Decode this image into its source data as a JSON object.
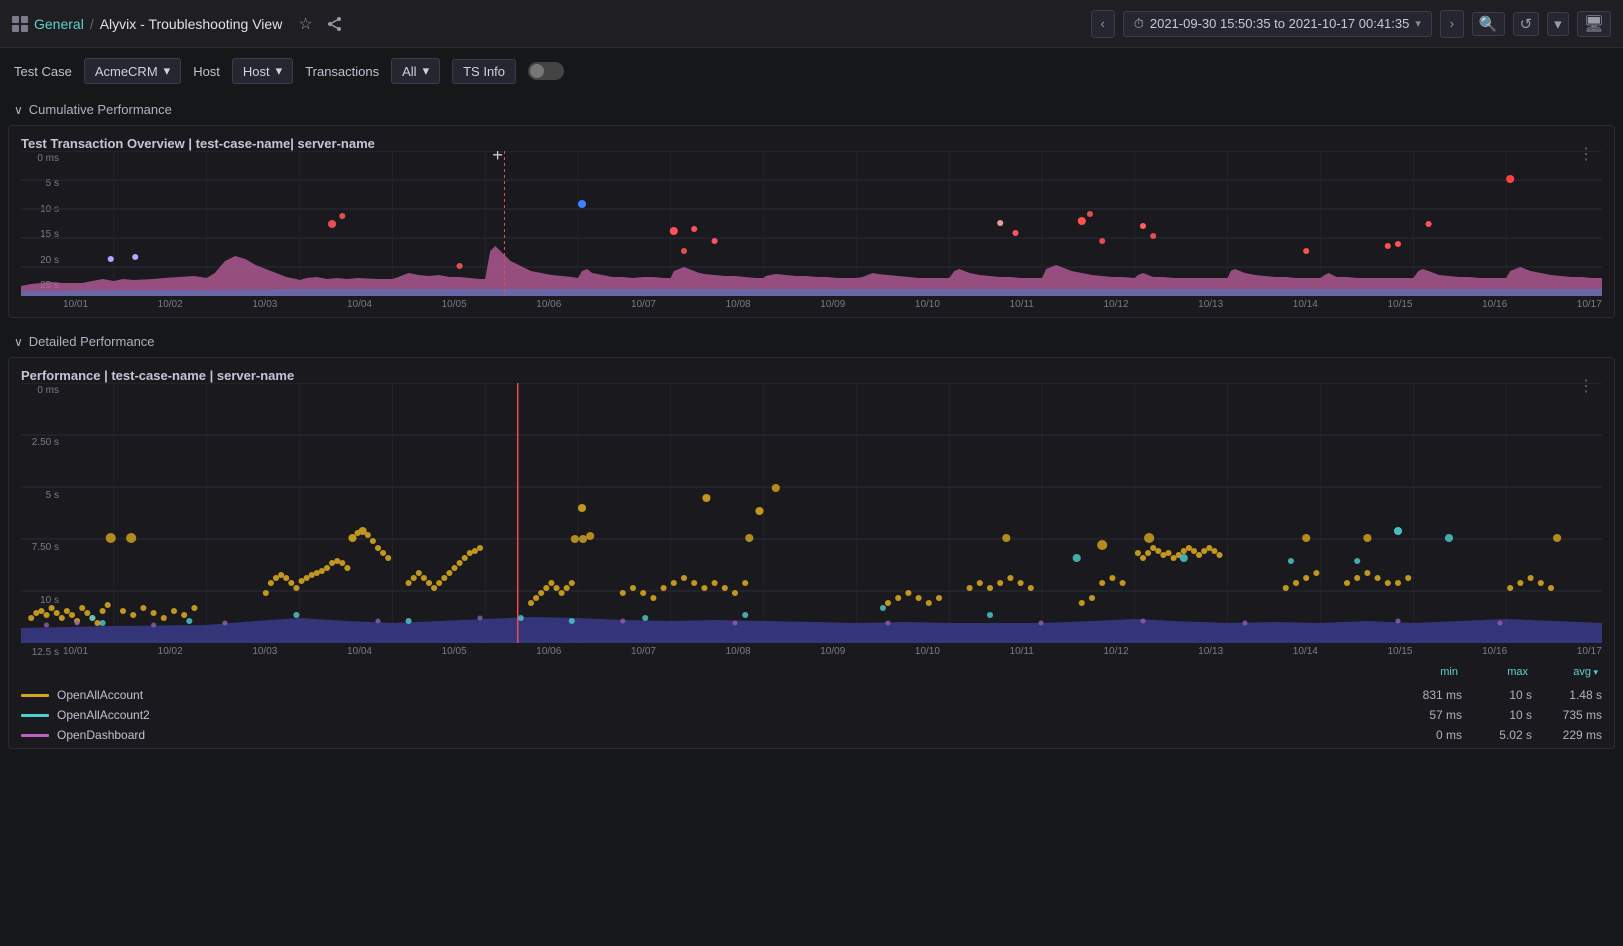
{
  "topbar": {
    "app_icon": "grid-icon",
    "breadcrumb_general": "General",
    "breadcrumb_sep": "/",
    "breadcrumb_title": "Alyvix - Troubleshooting View",
    "time_range": "2021-09-30 15:50:35 to 2021-10-17 00:41:35",
    "star_icon": "★",
    "share_icon": "⎘",
    "search_icon": "🔍",
    "refresh_icon": "↺",
    "chevron_down": "▾",
    "monitor_icon": "🖥",
    "prev_icon": "‹",
    "next_icon": "›"
  },
  "filters": {
    "test_case_label": "Test Case",
    "test_case_value": "AcmeCRM",
    "host_label": "Host",
    "host_value": "Host",
    "transactions_label": "Transactions",
    "transactions_value": "All",
    "ts_info_label": "TS Info"
  },
  "cumulative_section": {
    "label": "Cumulative Performance",
    "collapse_icon": "∨"
  },
  "chart1": {
    "title": "Test Transaction Overview | test-case-name| server-name",
    "more_icon": "⋮",
    "y_labels": [
      "25 s",
      "20 s",
      "15 s",
      "10 s",
      "5 s",
      "0 ms"
    ],
    "x_labels": [
      "10/01",
      "10/02",
      "10/03",
      "10/04",
      "10/05",
      "10/06",
      "10/07",
      "10/08",
      "10/09",
      "10/10",
      "10/11",
      "10/12",
      "10/13",
      "10/14",
      "10/15",
      "10/16",
      "10/17"
    ]
  },
  "detailed_section": {
    "label": "Detailed Performance",
    "collapse_icon": "∨"
  },
  "chart2": {
    "title": "Performance | test-case-name | server-name",
    "more_icon": "⋮",
    "y_labels": [
      "12.5 s",
      "10 s",
      "7.50 s",
      "5 s",
      "2.50 s",
      "0 ms"
    ],
    "x_labels": [
      "10/01",
      "10/02",
      "10/03",
      "10/04",
      "10/05",
      "10/06",
      "10/07",
      "10/08",
      "10/09",
      "10/10",
      "10/11",
      "10/12",
      "10/13",
      "10/14",
      "10/15",
      "10/16",
      "10/17"
    ]
  },
  "legend": {
    "stat_min": "min",
    "stat_max": "max",
    "stat_avg": "avg",
    "items": [
      {
        "name": "OpenAllAccount",
        "color": "#d4a520",
        "min": "831 ms",
        "max": "10 s",
        "avg": "1.48 s"
      },
      {
        "name": "OpenAllAccount2",
        "color": "#4ecfcf",
        "min": "57 ms",
        "max": "10 s",
        "avg": "735 ms"
      },
      {
        "name": "OpenDashboard",
        "color": "#c060c0",
        "min": "0 ms",
        "max": "5.02 s",
        "avg": "229 ms"
      }
    ]
  }
}
